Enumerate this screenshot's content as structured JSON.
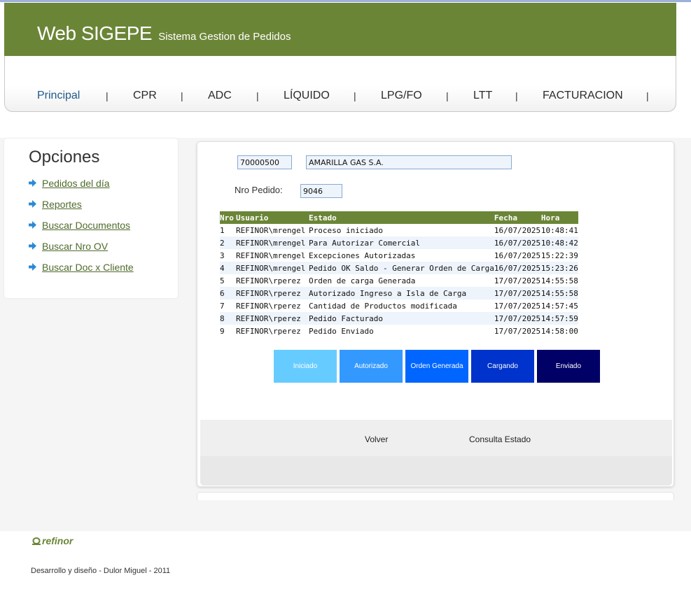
{
  "header": {
    "title": "Web SIGEPE",
    "subtitle": "Sistema Gestion de Pedidos"
  },
  "nav": {
    "items": [
      "Principal",
      "CPR",
      "ADC",
      "LÍQUIDO",
      "LPG/FO",
      "LTT",
      "FACTURACION"
    ],
    "separator": "|"
  },
  "sidebar": {
    "title": "Opciones",
    "items": [
      "Pedidos del día",
      "Reportes",
      "Buscar Documentos",
      "Buscar Nro OV",
      "Buscar Doc x Cliente"
    ]
  },
  "form": {
    "client_code": "70000500",
    "client_name": "AMARILLA GAS S.A.",
    "order_label": "Nro Pedido:",
    "order_number": "9046"
  },
  "table": {
    "headers": [
      "Nro",
      "Usuario",
      "Estado",
      "Fecha",
      "Hora"
    ],
    "rows": [
      [
        "1",
        "REFINOR\\mrengel",
        "Proceso iniciado",
        "16/07/2025",
        "10:48:41"
      ],
      [
        "2",
        "REFINOR\\mrengel",
        "Para Autorizar Comercial",
        "16/07/2025",
        "10:48:42"
      ],
      [
        "3",
        "REFINOR\\mrengel",
        "Excepciones Autorizadas",
        "16/07/2025",
        "15:22:39"
      ],
      [
        "4",
        "REFINOR\\mrengel",
        "Pedido OK Saldo - Generar Orden de Carga",
        "16/07/2025",
        "15:23:26"
      ],
      [
        "5",
        "REFINOR\\rperez",
        "Orden de carga Generada",
        "17/07/2025",
        "14:55:58"
      ],
      [
        "6",
        "REFINOR\\rperez",
        "Autorizado Ingreso a Isla de Carga",
        "17/07/2025",
        "14:55:58"
      ],
      [
        "7",
        "REFINOR\\rperez",
        "Cantidad de Productos modificada",
        "17/07/2025",
        "14:57:45"
      ],
      [
        "8",
        "REFINOR\\rperez",
        "Pedido Facturado",
        "17/07/2025",
        "14:57:59"
      ],
      [
        "9",
        "REFINOR\\rperez",
        "Pedido Enviado",
        "17/07/2025",
        "14:58:00"
      ]
    ]
  },
  "stages": [
    {
      "label": "Iniciado",
      "color": "#66ccff"
    },
    {
      "label": "Autorizado",
      "color": "#3399ff"
    },
    {
      "label": "Orden Generada",
      "color": "#0066ff"
    },
    {
      "label": "Cargando",
      "color": "#0033cc"
    },
    {
      "label": "Enviado",
      "color": "#000066"
    }
  ],
  "actions": {
    "back": "Volver",
    "status": "Consulta Estado"
  },
  "footer": {
    "logo": "refinor",
    "credit": "Desarrollo y diseño - Dulor Miguel - 2011"
  },
  "colors": {
    "brand_green": "#6b8537",
    "link_green": "#4f6a2b",
    "arrow_blue": "#2a8ad4"
  }
}
